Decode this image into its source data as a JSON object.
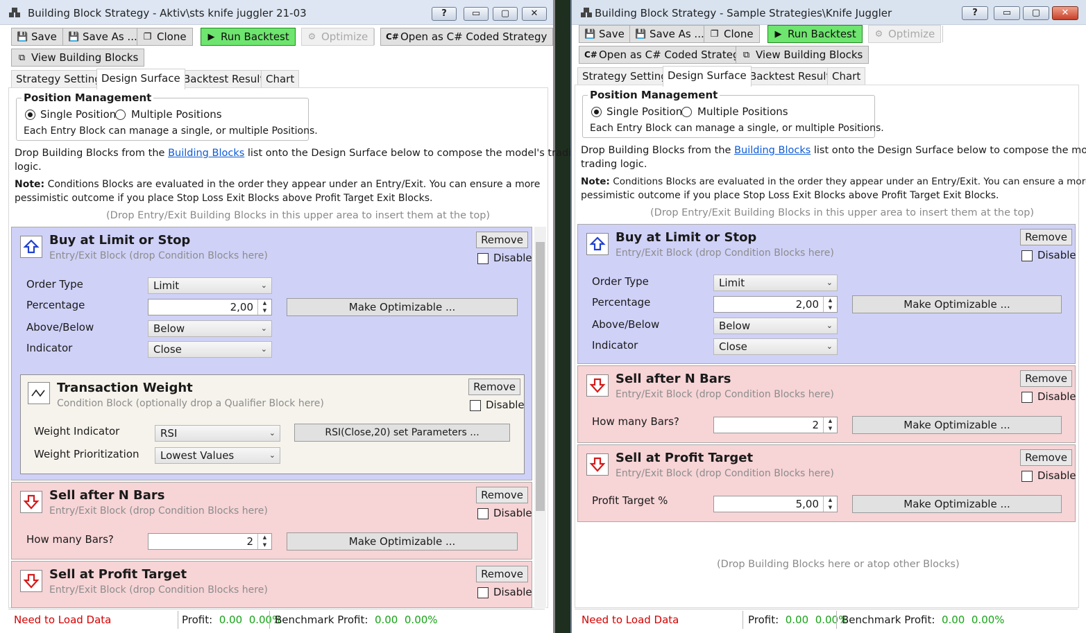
{
  "shared": {
    "toolbar": {
      "save": "Save",
      "save_as": "Save As ...",
      "clone": "Clone",
      "run_backtest": "Run Backtest",
      "optimize": "Optimize",
      "open_csharp": "Open as C# Coded Strategy",
      "view_blocks": "View Building Blocks"
    },
    "tabs": [
      "Strategy Settings",
      "Design Surface",
      "Backtest Results",
      "Chart"
    ],
    "position_management": {
      "legend": "Position Management",
      "single": "Single Position",
      "multiple": "Multiple Positions",
      "note": "Each Entry Block can manage a single, or multiple Positions."
    },
    "drop_intro_pre": "Drop Building Blocks from the",
    "drop_intro_link": "Building Blocks",
    "note_label": "Note:",
    "drop_top_hint": "(Drop Entry/Exit Building Blocks in this upper area to insert them at the top)",
    "drop_bottom_hint": "(Drop Building Blocks here or atop other Blocks)",
    "remove": "Remove",
    "disable": "Disable",
    "make_optimizable": "Make Optimizable ...",
    "entry_exit_sub": "Entry/Exit Block (drop Condition Blocks here)",
    "buy_title": "Buy at Limit or Stop",
    "order_type_label": "Order Type",
    "order_type_value": "Limit",
    "percentage_label": "Percentage",
    "percentage_value": "2,00",
    "above_below_label": "Above/Below",
    "above_below_value": "Below",
    "indicator_label": "Indicator",
    "indicator_value": "Close",
    "sell_bars_title": "Sell after N Bars",
    "bars_label": "How many Bars?",
    "bars_value": "2",
    "sell_profit_title": "Sell at Profit Target",
    "profit_label": "Profit Target %",
    "profit_value": "5,00",
    "status": {
      "need_data": "Need to Load Data",
      "profit_label": "Profit:",
      "profit_value": "0.00",
      "profit_pct": "0.00%",
      "bench_label": "Benchmark Profit:",
      "bench_value": "0.00",
      "bench_pct": "0.00%"
    },
    "window_buttons": {
      "help": "?",
      "minimize": "▭",
      "maximize": "▢",
      "close": "✕"
    },
    "colors": {
      "entry_block": "#cfd1f7",
      "exit_block": "#f7d4d6",
      "condition_block": "#f6f3ec",
      "run_button": "#6ee56e",
      "status_red": "#d40000",
      "status_green": "#16a316"
    }
  },
  "left": {
    "title": "Building Block Strategy - Aktiv\\sts knife juggler 21-03",
    "drop_intro_line1_rest": "list onto the Design Surface below to compose the model's trading",
    "drop_intro_line2": "logic.",
    "note_line1_rest": "Conditions Blocks are evaluated in the order they appear under an Entry/Exit. You can ensure a more",
    "note_line2": "pessimistic outcome if you place Stop Loss Exit Blocks above Profit Target Exit Blocks.",
    "condition": {
      "title": "Transaction Weight",
      "sub": "Condition Block (optionally drop a Qualifier Block here)",
      "weight_indicator_label": "Weight Indicator",
      "weight_indicator_value": "RSI",
      "params_button": "RSI(Close,20) set Parameters ...",
      "weight_prio_label": "Weight Prioritization",
      "weight_prio_value": "Lowest Values"
    }
  },
  "right": {
    "title": "Building Block Strategy - Sample Strategies\\Knife Juggler",
    "drop_intro_line1_rest": "list onto the Design Surface below to compose the model's",
    "drop_intro_line2": "trading logic.",
    "note_line1_rest": "Conditions Blocks are evaluated in the order they appear under an Entry/Exit. You can ensure a more",
    "note_line2": "pessimistic outcome if you place Stop Loss Exit Blocks above Profit Target Exit Blocks."
  }
}
